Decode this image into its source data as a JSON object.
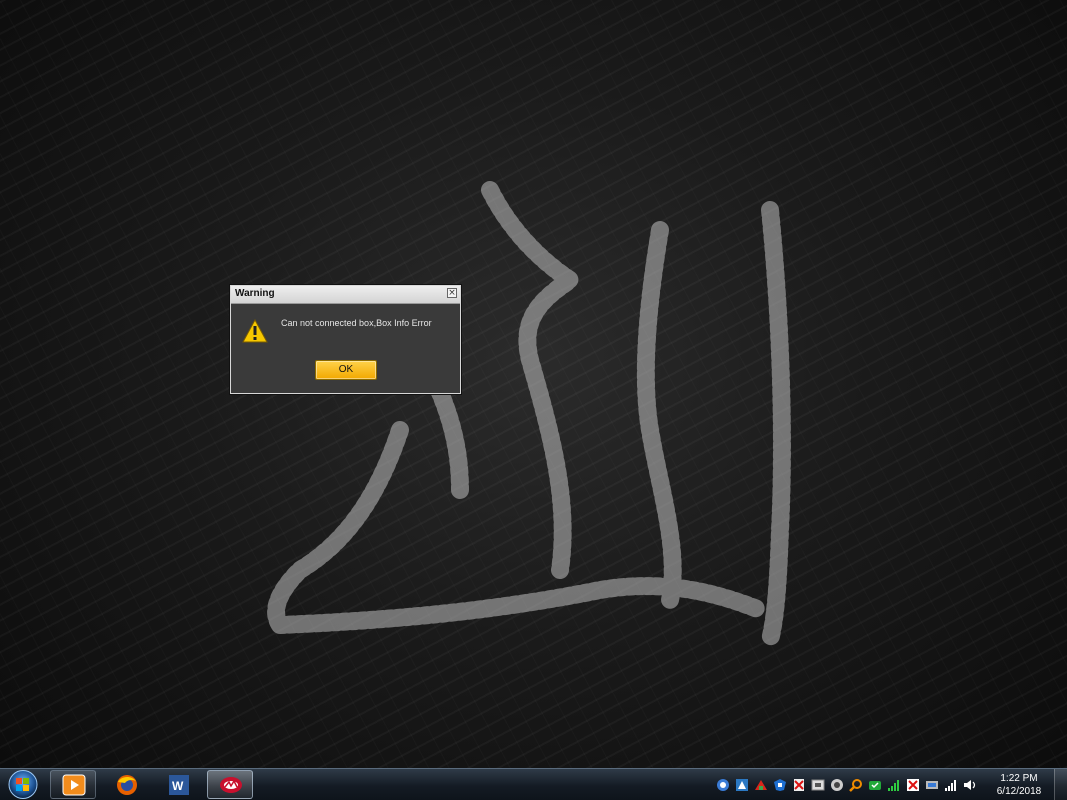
{
  "dialog": {
    "title": "Warning",
    "close_glyph": "×",
    "message": "Can not connected box,Box Info Error",
    "ok_label": "OK"
  },
  "taskbar": {
    "pinned": [
      {
        "name": "windows-media-player-icon"
      },
      {
        "name": "firefox-icon"
      },
      {
        "name": "microsoft-word-icon"
      },
      {
        "name": "box-tool-app-icon",
        "active": true
      }
    ],
    "tray_icons": [
      "tray-app-icon-1",
      "tray-app-icon-2",
      "tray-app-icon-3",
      "tray-app-icon-4",
      "tray-app-icon-5",
      "tray-app-icon-6",
      "tray-app-icon-7",
      "tray-search-icon",
      "tray-app-icon-8",
      "tray-signal-icon",
      "tray-app-icon-9",
      "tray-app-icon-10",
      "network-signal-icon",
      "volume-icon"
    ],
    "clock": {
      "time": "1:22 PM",
      "date": "6/12/2018"
    }
  },
  "colors": {
    "ok_button": "#f2a800",
    "dialog_body": "#3a3a3a",
    "taskbar": "#141b24"
  }
}
